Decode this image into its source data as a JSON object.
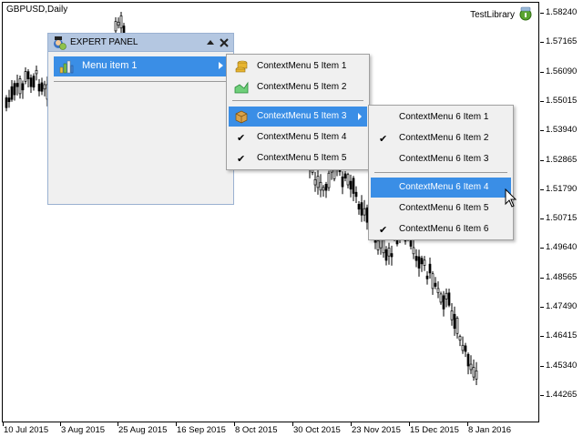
{
  "chart": {
    "symbol_label": "GBPUSD,Daily",
    "indicator_label": "TestLibrary",
    "indicator_icon": "info-badge-icon",
    "price_levels": [
      "1.58240",
      "1.57165",
      "1.56090",
      "1.55015",
      "1.53940",
      "1.52865",
      "1.51790",
      "1.50715",
      "1.49640",
      "1.48565",
      "1.47490",
      "1.46415",
      "1.45340",
      "1.44265"
    ],
    "time_labels": [
      "10 Jul 2015",
      "3 Aug 2015",
      "25 Aug 2015",
      "16 Sep 2015",
      "8 Oct 2015",
      "30 Oct 2015",
      "23 Nov 2015",
      "15 Dec 2015",
      "8 Jan 2016"
    ],
    "colors": {
      "candle": "#000000",
      "background": "#ffffff"
    }
  },
  "expert_panel": {
    "title": "EXPERT PANEL",
    "header_icon": "expert-avatar-icon",
    "collapse_icon": "chevron-up-icon",
    "close_icon": "close-icon",
    "menu_item": {
      "label": "Menu item 1",
      "icon": "bar-chart-icon",
      "has_submenu": true
    },
    "colors": {
      "header": "#b4c7e1",
      "highlight": "#3a8ee6",
      "body": "#f0f0f0"
    }
  },
  "context_menu_5": {
    "items": [
      {
        "label": "ContextMenu 5 Item 1",
        "icon": "coins-icon",
        "checked": false,
        "highlighted": false,
        "has_submenu": false
      },
      {
        "label": "ContextMenu 5 Item 2",
        "icon": "area-chart-icon",
        "checked": false,
        "highlighted": false,
        "has_submenu": false
      },
      {
        "label": "ContextMenu 5 Item 3",
        "icon": "package-icon",
        "checked": false,
        "highlighted": true,
        "has_submenu": true
      },
      {
        "label": "ContextMenu 5 Item 4",
        "icon": "checkmark-icon",
        "checked": true,
        "highlighted": false,
        "has_submenu": false
      },
      {
        "label": "ContextMenu 5 Item 5",
        "icon": "checkmark-icon",
        "checked": true,
        "highlighted": false,
        "has_submenu": false
      }
    ]
  },
  "context_menu_6": {
    "items": [
      {
        "label": "ContextMenu 6 Item 1",
        "checked": false,
        "highlighted": false
      },
      {
        "label": "ContextMenu 6 Item 2",
        "checked": true,
        "highlighted": false
      },
      {
        "label": "ContextMenu 6 Item 3",
        "checked": false,
        "highlighted": false
      },
      {
        "label": "ContextMenu 6 Item 4",
        "checked": false,
        "highlighted": true
      },
      {
        "label": "ContextMenu 6 Item 5",
        "checked": false,
        "highlighted": false
      },
      {
        "label": "ContextMenu 6 Item 6",
        "checked": true,
        "highlighted": false
      }
    ],
    "check_glyph": "✔"
  }
}
